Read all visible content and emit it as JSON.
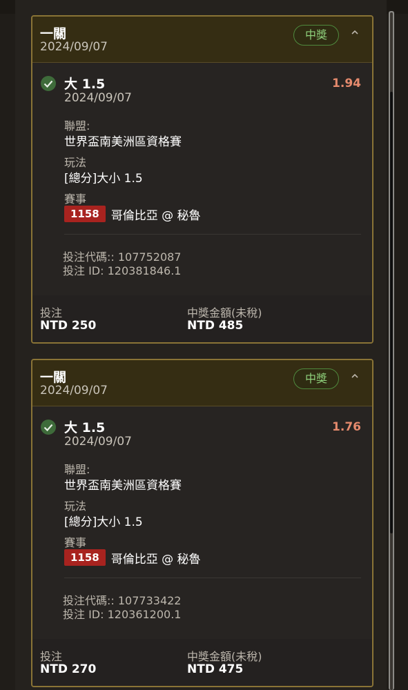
{
  "bets": [
    {
      "header": {
        "title": "一關",
        "date": "2024/09/07",
        "status": "中獎"
      },
      "selection": "大 1.5",
      "odds": "1.94",
      "bet_date": "2024/09/07",
      "league_label": "聯盟:",
      "league": "世界盃南美洲區資格賽",
      "type_label": "玩法",
      "type": "[總分]大小 1.5",
      "match_label": "賽事",
      "match_code": "1158",
      "match_name": "哥倫比亞 @ 秘魯",
      "bet_code": "投注代碼:: 107752087",
      "bet_id": "投注 ID: 120381846.1",
      "stake_label": "投注",
      "stake": "NTD 250",
      "payout_label": "中獎金額(未稅)",
      "payout": "NTD 485"
    },
    {
      "header": {
        "title": "一關",
        "date": "2024/09/07",
        "status": "中獎"
      },
      "selection": "大 1.5",
      "odds": "1.76",
      "bet_date": "2024/09/07",
      "league_label": "聯盟:",
      "league": "世界盃南美洲區資格賽",
      "type_label": "玩法",
      "type": "[總分]大小 1.5",
      "match_label": "賽事",
      "match_code": "1158",
      "match_name": "哥倫比亞 @ 秘魯",
      "bet_code": "投注代碼:: 107733422",
      "bet_id": "投注 ID: 120361200.1",
      "stake_label": "投注",
      "stake": "NTD 270",
      "payout_label": "中獎金額(未稅)",
      "payout": "NTD 475"
    }
  ],
  "icons": {
    "check": "check-circle-icon",
    "collapse": "chevron-up-icon"
  },
  "colors": {
    "card_border": "#8a7436",
    "header_bg": "#352d13",
    "win_green": "#8fd17c",
    "odds": "#e58a6d",
    "match_code_bg": "#a8231f"
  }
}
